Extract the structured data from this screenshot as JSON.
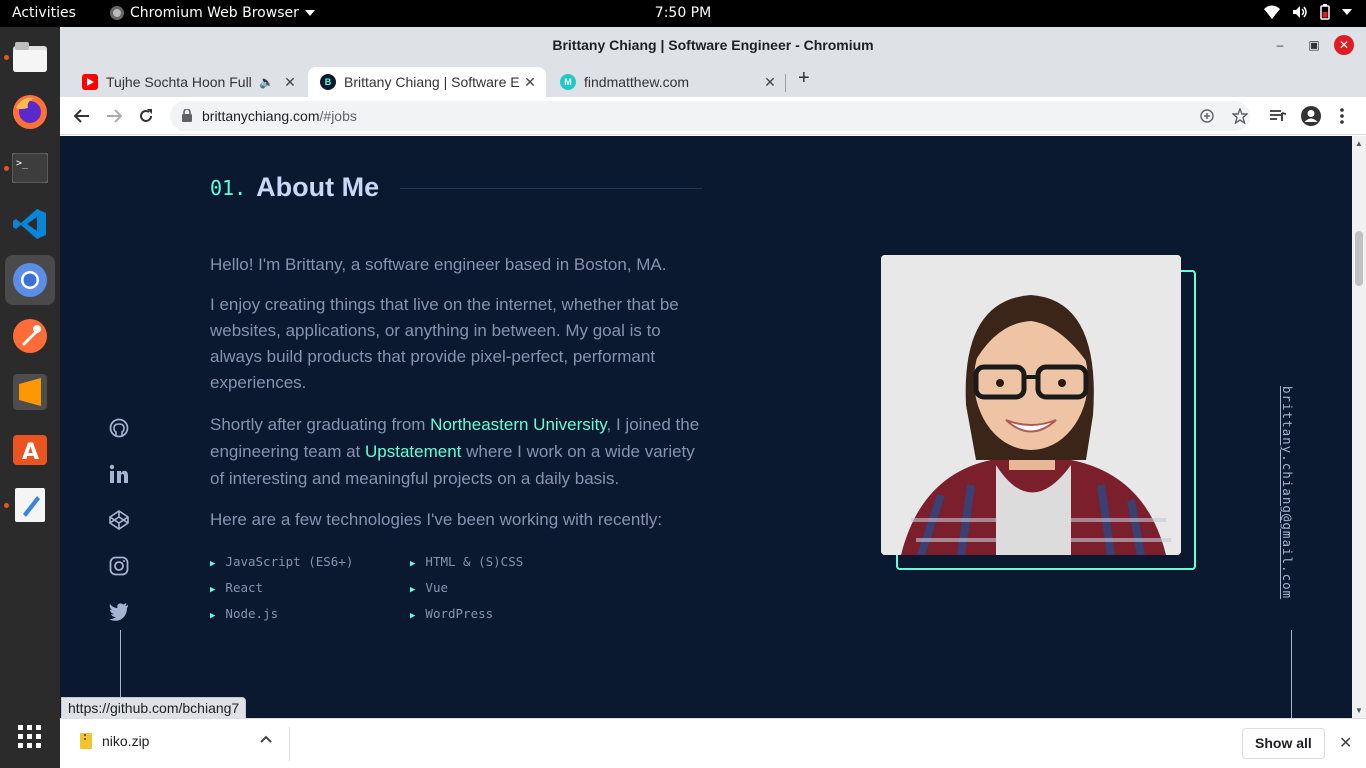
{
  "system": {
    "activities": "Activities",
    "app_name": "Chromium Web Browser",
    "clock": "7:50 PM"
  },
  "dock": {
    "items": [
      "files",
      "firefox",
      "terminal",
      "vscode",
      "chromium",
      "postman",
      "sublime-text",
      "software-center",
      "text-editor"
    ],
    "apps_grid": "show-applications"
  },
  "browser": {
    "window_title": "Brittany Chiang | Software Engineer - Chromium",
    "tabs": [
      {
        "label": "Tujhe Sochta Hoon Full",
        "favicon": "youtube"
      },
      {
        "label": "Brittany Chiang | Software Engineer",
        "favicon": "b-hex"
      },
      {
        "label": "findmatthew.com",
        "favicon": "m-circle"
      }
    ],
    "url_host": "brittanychiang.com",
    "url_path": "/#jobs",
    "status_url": "https://github.com/bchiang7"
  },
  "page": {
    "section_number": "01.",
    "section_title": "About Me",
    "p1": "Hello! I'm Brittany, a software engineer based in Boston, MA.",
    "p2": "I enjoy creating things that live on the internet, whether that be websites, applications, or anything in between. My goal is to always build products that provide pixel-perfect, performant experiences.",
    "p3_a": "Shortly after graduating from ",
    "p3_link1": "Northeastern University",
    "p3_b": ", I joined the engineering team at ",
    "p3_link2": "Upstatement",
    "p3_c": " where I work on a wide variety of interesting and meaningful projects on a daily basis.",
    "p4": "Here are a few technologies I've been working with recently:",
    "technologies": [
      "JavaScript (ES6+)",
      "HTML & (S)CSS",
      "React",
      "Vue",
      "Node.js",
      "WordPress"
    ],
    "email": "brittany.chiang@gmail.com",
    "social": [
      "github",
      "linkedin",
      "codepen",
      "instagram",
      "twitter"
    ],
    "colors": {
      "bg": "#0a192f",
      "accent": "#64ffda",
      "text": "#8892b0",
      "heading": "#ccd6f6"
    }
  },
  "downloads": {
    "file": "niko.zip",
    "show_all": "Show all"
  }
}
